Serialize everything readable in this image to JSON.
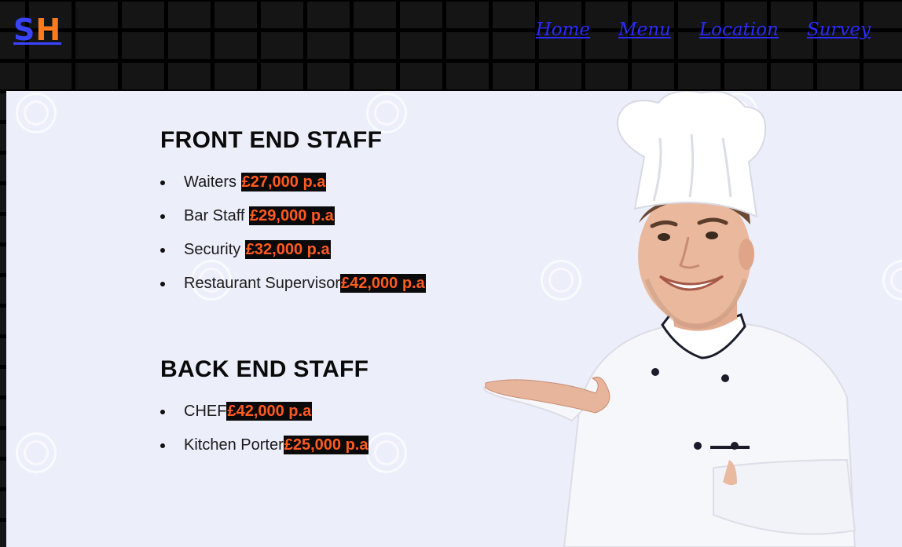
{
  "brand": {
    "logo_part1": "S",
    "logo_part2": "H",
    "color_primary": "#3a44ff",
    "color_secondary": "#ff7a1a"
  },
  "nav": {
    "items": [
      {
        "label": "Home"
      },
      {
        "label": "Menu"
      },
      {
        "label": "Location"
      },
      {
        "label": "Survey"
      }
    ]
  },
  "front_end": {
    "title": "FRONT END STAFF",
    "items": [
      {
        "role": "Waiters",
        "salary": "£27,000 p.a"
      },
      {
        "role": "Bar Staff",
        "salary": "£29,000 p.a"
      },
      {
        "role": "Security",
        "salary": "£32,000 p.a"
      },
      {
        "role": "Restaurant Supervisor",
        "salary": "£42,000 p.a"
      }
    ]
  },
  "back_end": {
    "title": "BACK END STAFF",
    "items": [
      {
        "role": "CHEF",
        "salary": "£42,000 p.a"
      },
      {
        "role": "Kitchen Porter",
        "salary": "£25,000 p.a"
      }
    ]
  },
  "colors": {
    "panel_bg": "#eceefa",
    "salary_text": "#ff5a1f",
    "salary_bg": "#0a0a0a",
    "link": "#2a2aff"
  },
  "image": {
    "subject_icon": "chef-illustration"
  }
}
